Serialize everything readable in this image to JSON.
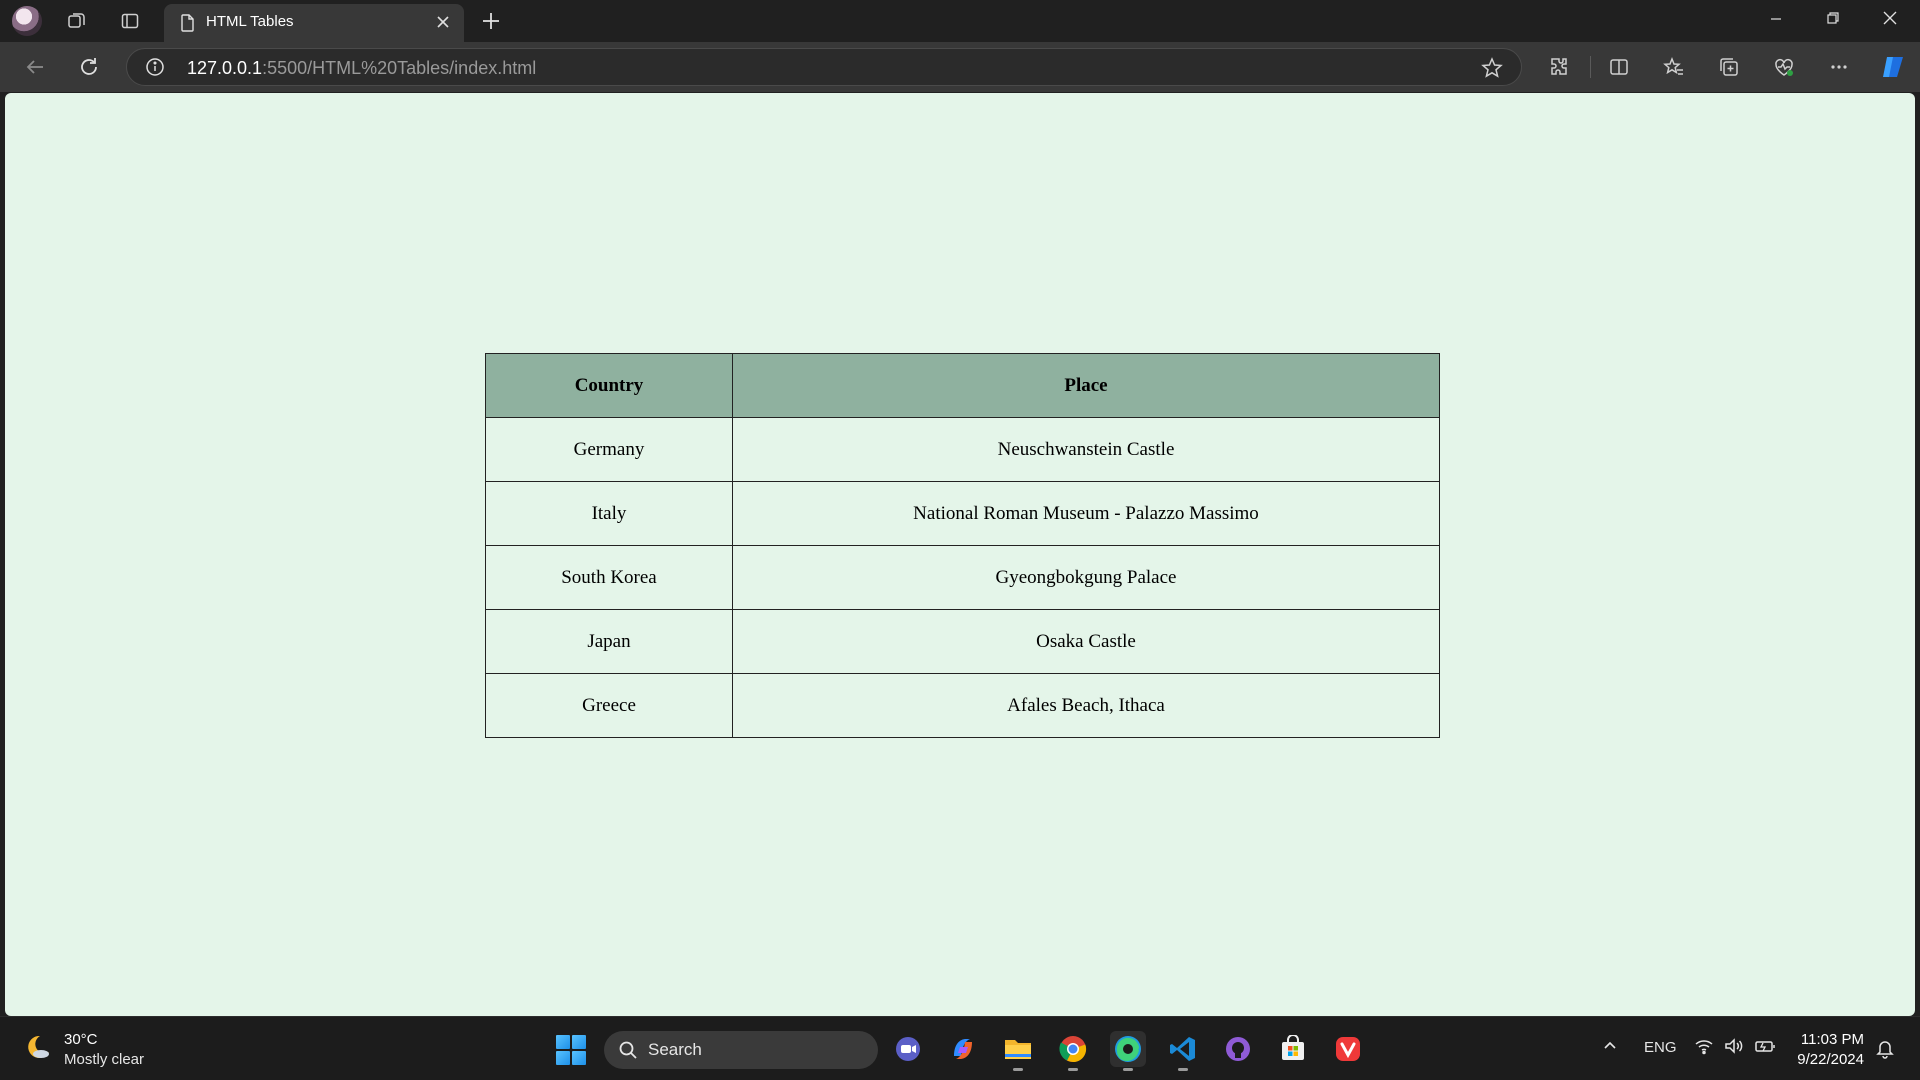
{
  "browser": {
    "tab_title": "HTML Tables",
    "url_host": "127.0.0.1",
    "url_rest": ":5500/HTML%20Tables/index.html"
  },
  "page": {
    "background": "#e4f5e9",
    "header_background": "#8fb19f",
    "table": {
      "headers": [
        "Country",
        "Place"
      ],
      "rows": [
        [
          "Germany",
          "Neuschwanstein Castle"
        ],
        [
          "Italy",
          "National Roman Museum - Palazzo Massimo"
        ],
        [
          "South Korea",
          "Gyeongbokgung Palace"
        ],
        [
          "Japan",
          "Osaka Castle"
        ],
        [
          "Greece",
          "Afales Beach, Ithaca"
        ]
      ]
    }
  },
  "taskbar": {
    "weather_temp": "30°C",
    "weather_desc": "Mostly clear",
    "search_label": "Search",
    "language": "ENG",
    "time": "11:03 PM",
    "date": "9/22/2024",
    "apps": [
      "video-call-icon",
      "copilot-icon",
      "file-explorer-icon",
      "chrome-icon",
      "edge-icon",
      "vscode-icon",
      "github-icon",
      "store-icon",
      "vivaldi-icon"
    ]
  }
}
